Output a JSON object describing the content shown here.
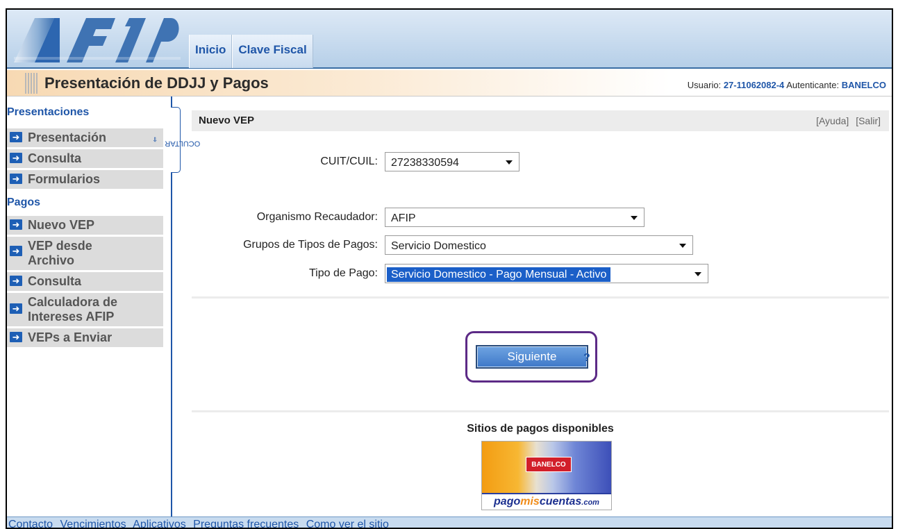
{
  "header": {
    "logo_text": "AFIP",
    "nav": [
      "Inicio",
      "Clave Fiscal"
    ]
  },
  "titlebar": {
    "title": "Presentación de DDJJ y Pagos",
    "usuario_label": "Usuario:",
    "usuario_value": "27-11062082-4",
    "autenticante_label": "Autenticante:",
    "autenticante_value": "BANELCO"
  },
  "sidebar": {
    "sections": [
      {
        "title": "Presentaciones",
        "items": [
          "Presentación",
          "Consulta",
          "Formularios"
        ]
      },
      {
        "title": "Pagos",
        "items": [
          "Nuevo VEP",
          "VEP desde Archivo",
          "Consulta",
          "Calculadora de Intereses AFIP",
          "VEPs a Enviar"
        ]
      }
    ],
    "toggle_label": "OCULTAR"
  },
  "panel": {
    "title": "Nuevo VEP",
    "ayuda": "[Ayuda]",
    "salir": "[Salir]"
  },
  "form": {
    "cuit_label": "CUIT/CUIL:",
    "cuit_value": "27238330594",
    "organismo_label": "Organismo Recaudador:",
    "organismo_value": "AFIP",
    "grupos_label": "Grupos de Tipos de Pagos:",
    "grupos_value": "Servicio Domestico",
    "tipo_label": "Tipo de Pago:",
    "tipo_value": "Servicio Domestico - Pago Mensual - Activo"
  },
  "actions": {
    "siguiente": "Siguiente",
    "help": "?"
  },
  "sitios": {
    "title": "Sitios de pagos disponibles",
    "banner_brand": "BANELCO",
    "banner_text_1": "pago",
    "banner_text_2": "mis",
    "banner_text_3": "cuentas",
    "banner_text_4": ".com"
  },
  "footer": {
    "links": [
      "Contacto",
      "Vencimientos",
      "Aplicativos",
      "Preguntas frecuentes",
      "Como ver el sitio"
    ]
  },
  "colors": {
    "link_blue": "#1f56a8",
    "highlight_purple": "#5c2a86",
    "selection_blue": "#1b5fc8"
  }
}
